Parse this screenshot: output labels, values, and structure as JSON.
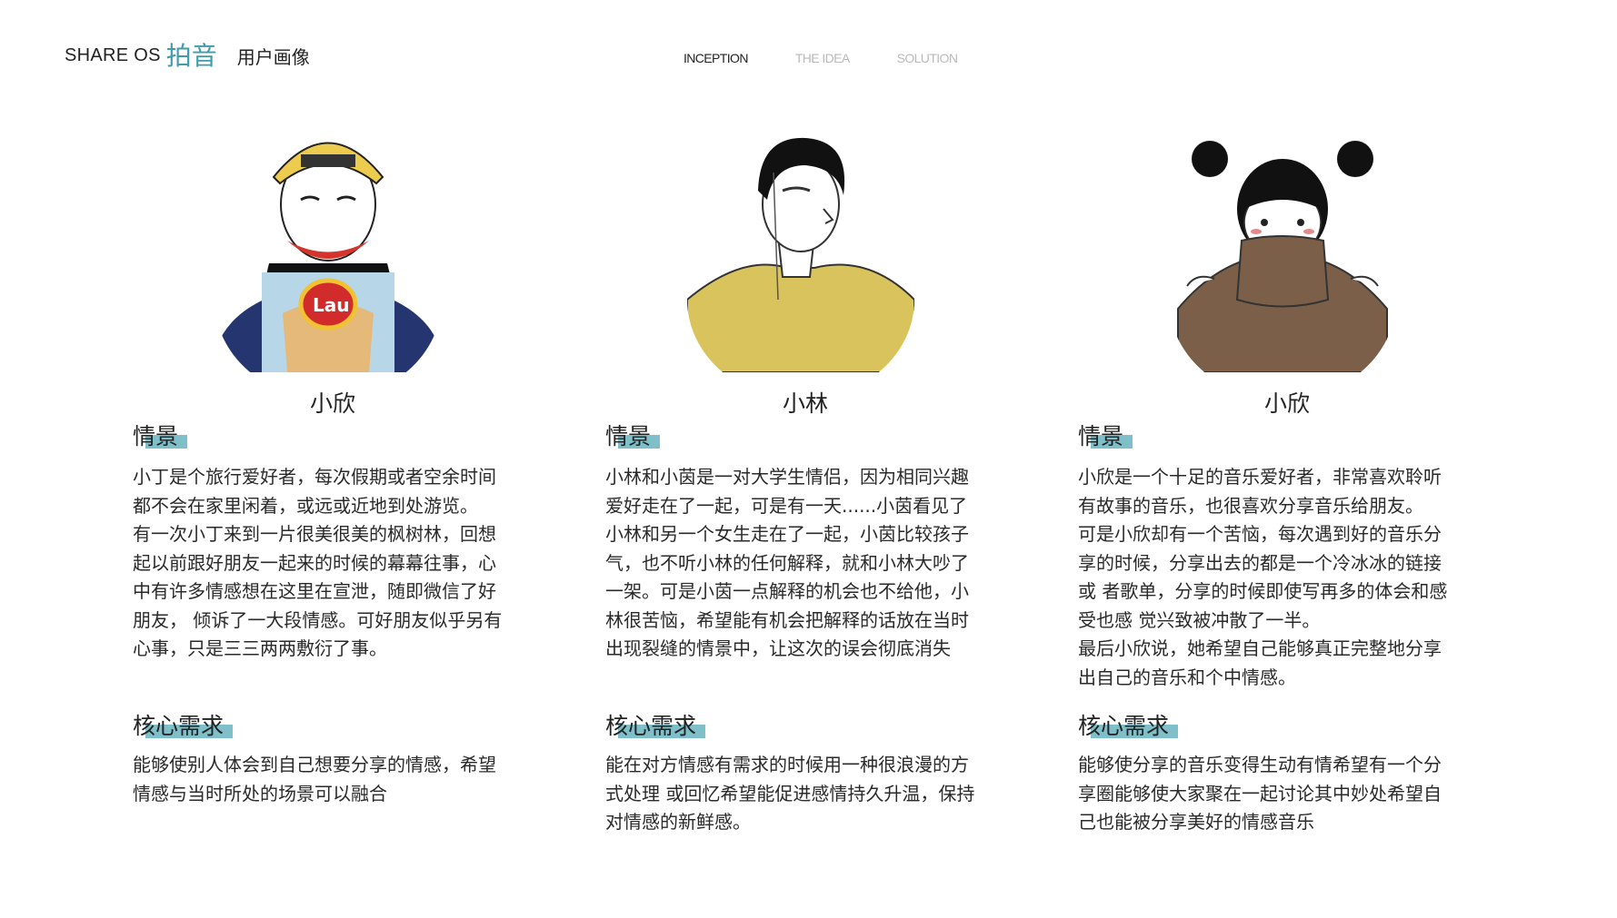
{
  "header": {
    "brand": "SHARE OS",
    "logo_text": "拍音",
    "subtitle": "用户画像",
    "nav": [
      {
        "label": "INCEPTION",
        "active": true
      },
      {
        "label": "THE IDEA",
        "active": false
      },
      {
        "label": "SOLUTION",
        "active": false
      }
    ]
  },
  "colors": {
    "accent": "#7fbfc9",
    "logo": "#3e9cab",
    "inactive_nav": "#b9b9b9"
  },
  "personas": [
    {
      "name": "小欣",
      "scene_title": "情景",
      "scene_text": "小丁是个旅行爱好者，每次假期或者空余时间\n都不会在家里闲着，或远或近地到处游览。\n有一次小丁来到一片很美很美的枫树林，回想\n起以前跟好朋友一起来的时候的幕幕往事，心\n中有许多情感想在这里在宣泄，随即微信了好\n朋友， 倾诉了一大段情感。可好朋友似乎另有\n心事，只是三三两两敷衍了事。",
      "need_title": "核心需求",
      "need_text": "能够使别人体会到自己想要分享的情感，希望\n情感与当时所处的场景可以融合"
    },
    {
      "name": "小林",
      "scene_title": "情景",
      "scene_text": "小林和小茵是一对大学生情侣，因为相同兴趣\n爱好走在了一起，可是有一天......小茵看见了\n小林和另一个女生走在了一起，小茵比较孩子\n气，也不听小林的任何解释，就和小林大吵了\n一架。可是小茵一点解释的机会也不给他，小\n林很苦恼，希望能有机会把解释的话放在当时\n出现裂缝的情景中，让这次的误会彻底消失",
      "need_title": "核心需求",
      "need_text": "能在对方情感有需求的时候用一种很浪漫的方\n式处理 或回忆希望能促进感情持久升温，保持\n对情感的新鲜感。"
    },
    {
      "name": "小欣",
      "scene_title": "情景",
      "scene_text": "小欣是一个十足的音乐爱好者，非常喜欢聆听\n有故事的音乐，也很喜欢分享音乐给朋友。\n可是小欣却有一个苦恼，每次遇到好的音乐分\n享的时候，分享出去的都是一个冷冰冰的链接\n或 者歌单，分享的时候即使写再多的体会和感\n受也感 觉兴致被冲散了一半。\n最后小欣说，她希望自己能够真正完整地分享\n出自己的音乐和个中情感。",
      "need_title": "核心需求",
      "need_text": "能够使分享的音乐变得生动有情希望有一个分\n享圈能够使大家聚在一起讨论其中妙处希望自\n己也能被分享美好的情感音乐"
    }
  ]
}
